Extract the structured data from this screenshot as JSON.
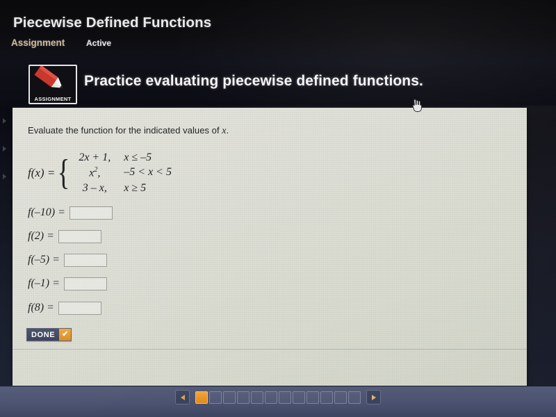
{
  "header": {
    "title": "Piecewise Defined Functions",
    "category": "Assignment",
    "status": "Active"
  },
  "banner": {
    "icon_caption": "ASSIGNMENT",
    "icon_name": "assignment-pencil-icon",
    "title": "Practice evaluating piecewise defined functions."
  },
  "content": {
    "prompt_before": "Evaluate the function for the indicated values of ",
    "prompt_variable": "x",
    "prompt_after": ".",
    "function_label": "f(x) =",
    "cases": [
      {
        "expression": "2x + 1,",
        "condition": "x ≤ –5"
      },
      {
        "expression": "x²,",
        "condition": "–5 < x < 5"
      },
      {
        "expression": "3 – x,",
        "condition": "x ≥ 5"
      }
    ],
    "answers": [
      {
        "label": "f(–10) =",
        "value": "",
        "placeholder": ""
      },
      {
        "label": "f(2) =",
        "value": "",
        "placeholder": ""
      },
      {
        "label": "f(–5) =",
        "value": "",
        "placeholder": ""
      },
      {
        "label": "f(–1) =",
        "value": "",
        "placeholder": ""
      },
      {
        "label": "f(8) =",
        "value": "",
        "placeholder": ""
      }
    ],
    "done_label": "DONE",
    "done_check_glyph": "✔"
  },
  "pagination": {
    "prev_label": "◀",
    "next_label": "▶",
    "total_pages": 12,
    "current_page": 1
  },
  "colors": {
    "accent_orange": "#e6961f",
    "bar_blue": "#4a5270",
    "done_navy": "#3f4660",
    "panel_bg": "#dedfd6",
    "category_tan": "#c9bb9a"
  }
}
